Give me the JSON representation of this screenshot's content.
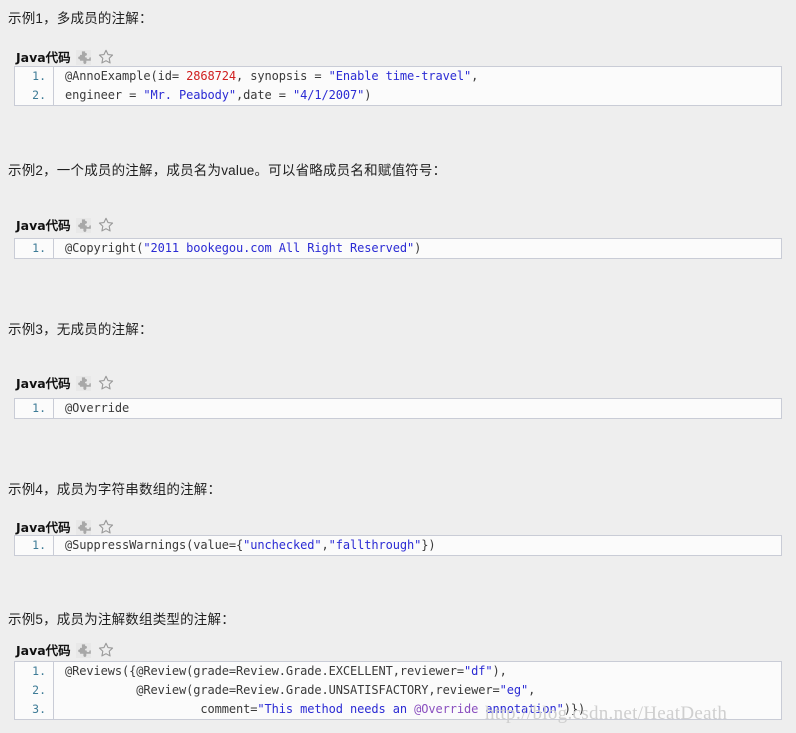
{
  "page": {
    "background_color": "#eeeeee",
    "watermark": {
      "text": "http://blog.csdn.net/HeatDeath",
      "color": "#cfcfcf"
    }
  },
  "icons": {
    "puzzle": "puzzle-piece-icon",
    "star": "star-outline-icon"
  },
  "colors": {
    "code_background": "#fbfbfb",
    "code_border": "#c9ccd6",
    "line_number": "#3d7b96",
    "string_token": "#2b2bd4",
    "number_token": "#d02020",
    "annotation_token": "#8a4fbf",
    "plain_token": "#3a3a3a"
  },
  "sections": [
    {
      "caption": "示例1，多成员的注解：",
      "code_header_label": "Java代码",
      "lines": [
        {
          "number": "1.",
          "tokens": [
            {
              "text": "@AnnoExample(id= ",
              "type": "plain"
            },
            {
              "text": "2868724",
              "type": "num"
            },
            {
              "text": ", synopsis = ",
              "type": "plain"
            },
            {
              "text": "\"Enable time-travel\"",
              "type": "str"
            },
            {
              "text": ",",
              "type": "plain"
            }
          ]
        },
        {
          "number": "2.",
          "tokens": [
            {
              "text": "engineer = ",
              "type": "plain"
            },
            {
              "text": "\"Mr. Peabody\"",
              "type": "str"
            },
            {
              "text": ",date = ",
              "type": "plain"
            },
            {
              "text": "\"4/1/2007\"",
              "type": "str"
            },
            {
              "text": ")",
              "type": "plain"
            }
          ]
        }
      ]
    },
    {
      "caption": "示例2，一个成员的注解，成员名为value。可以省略成员名和赋值符号：",
      "code_header_label": "Java代码",
      "lines": [
        {
          "number": "1.",
          "tokens": [
            {
              "text": "@Copyright(",
              "type": "plain"
            },
            {
              "text": "\"2011 bookegou.com All Right Reserved\"",
              "type": "str"
            },
            {
              "text": ")",
              "type": "plain"
            }
          ]
        }
      ]
    },
    {
      "caption": "示例3，无成员的注解：",
      "code_header_label": "Java代码",
      "lines": [
        {
          "number": "1.",
          "tokens": [
            {
              "text": "@Override",
              "type": "plain"
            }
          ]
        }
      ]
    },
    {
      "caption": "示例4，成员为字符串数组的注解：",
      "code_header_label": "Java代码",
      "lines": [
        {
          "number": "1.",
          "tokens": [
            {
              "text": "@SuppressWarnings(value={",
              "type": "plain"
            },
            {
              "text": "\"unchecked\"",
              "type": "str"
            },
            {
              "text": ",",
              "type": "plain"
            },
            {
              "text": "\"fallthrough\"",
              "type": "str"
            },
            {
              "text": "})",
              "type": "plain"
            }
          ]
        }
      ]
    },
    {
      "caption": "示例5，成员为注解数组类型的注解：",
      "code_header_label": "Java代码",
      "lines": [
        {
          "number": "1.",
          "tokens": [
            {
              "text": "@Reviews({@Review(grade=Review.Grade.EXCELLENT,reviewer=",
              "type": "plain"
            },
            {
              "text": "\"df\"",
              "type": "str"
            },
            {
              "text": "),",
              "type": "plain"
            }
          ]
        },
        {
          "number": "2.",
          "tokens": [
            {
              "text": "          @Review(grade=Review.Grade.UNSATISFACTORY,reviewer=",
              "type": "plain"
            },
            {
              "text": "\"eg\"",
              "type": "str"
            },
            {
              "text": ",",
              "type": "plain"
            }
          ]
        },
        {
          "number": "3.",
          "tokens": [
            {
              "text": "                   comment=",
              "type": "plain"
            },
            {
              "text": "\"This method needs an ",
              "type": "str"
            },
            {
              "text": "@Override",
              "type": "ann"
            },
            {
              "text": " annotation\"",
              "type": "str"
            },
            {
              "text": ")})",
              "type": "plain"
            }
          ]
        }
      ]
    }
  ]
}
